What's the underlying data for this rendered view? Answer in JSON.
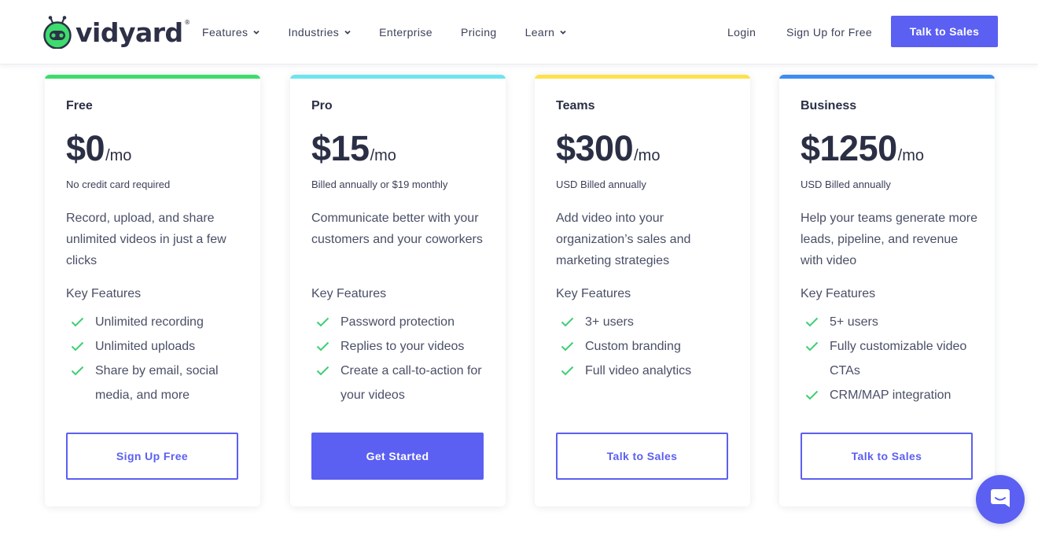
{
  "header": {
    "logo_text": "vidyard",
    "logo_reg": "®",
    "nav": [
      {
        "label": "Features",
        "has_dropdown": true
      },
      {
        "label": "Industries",
        "has_dropdown": true
      },
      {
        "label": "Enterprise",
        "has_dropdown": false
      },
      {
        "label": "Pricing",
        "has_dropdown": false
      },
      {
        "label": "Learn",
        "has_dropdown": true
      }
    ],
    "login_label": "Login",
    "signup_label": "Sign Up for Free",
    "talk_to_sales_label": "Talk to Sales"
  },
  "plans": [
    {
      "name": "Free",
      "amount": "$0",
      "unit": "/mo",
      "note": "No credit card required",
      "description": "Record, upload, and share unlimited videos in just a few clicks",
      "key_features_title": "Key Features",
      "features": [
        "Unlimited recording",
        "Unlimited uploads",
        "Share by email, social media, and more"
      ],
      "button_label": "Sign Up Free",
      "accent": "#3ddc6c"
    },
    {
      "name": "Pro",
      "amount": "$15",
      "unit": "/mo",
      "note": "Billed annually or $19 monthly",
      "description": "Communicate better with your customers and your coworkers",
      "key_features_title": "Key Features",
      "features": [
        "Password protection",
        "Replies to your videos",
        "Create a call-to-action for your videos"
      ],
      "button_label": "Get Started",
      "accent": "#6fe3ee"
    },
    {
      "name": "Teams",
      "amount": "$300",
      "unit": "/mo",
      "note": "USD Billed annually",
      "description": "Add video into your organization’s sales and marketing strategies",
      "key_features_title": "Key Features",
      "features": [
        "3+ users",
        "Custom branding",
        "Full video analytics"
      ],
      "button_label": "Talk to Sales",
      "accent": "#fde24a"
    },
    {
      "name": "Business",
      "amount": "$1250",
      "unit": "/mo",
      "note": "USD Billed annually",
      "description": "Help your teams generate more leads, pipeline, and revenue with video",
      "key_features_title": "Key Features",
      "features": [
        "5+ users",
        "Fully customizable video CTAs",
        "CRM/MAP integration"
      ],
      "button_label": "Talk to Sales",
      "accent": "#3d8ef0"
    }
  ],
  "colors": {
    "brand_purple": "#5b5ff2",
    "check_green": "#3ecf74",
    "logo_green": "#3ddc6c",
    "text_dark": "#2b2f45"
  },
  "icons": {
    "logo": "vidyard-robot-icon",
    "dropdown": "chevron-down-icon",
    "feature": "check-icon",
    "chat": "chat-bubble-icon"
  }
}
